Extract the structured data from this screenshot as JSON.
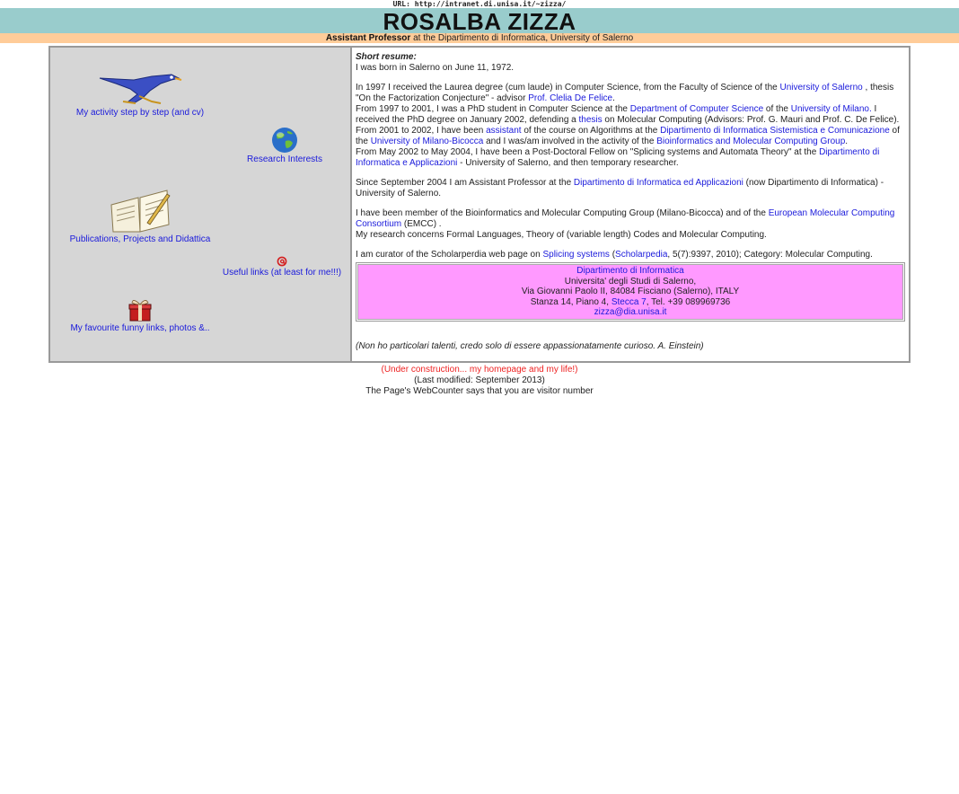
{
  "url_label": "URL: http://intranet.di.unisa.it/~zizza/",
  "title": "ROSALBA ZIZZA",
  "subtitle": {
    "role": "Assistant Professor",
    "affiliation": " at the Dipartimento di Informatica, University of Salerno"
  },
  "nav": {
    "activity": "My activity step by step (and cv)",
    "research": "Research Interests",
    "publications": "Publications, Projects and Didattica",
    "useful": "Useful links (at least for me!!!)",
    "funny": "My favourite funny links, photos &.."
  },
  "resume": {
    "heading": "Short resume:",
    "born": "I was born in  Salerno on June 11, 1972.",
    "p2": {
      "t1": "In 1997 I received the Laurea degree (cum laude) in Computer Science, from the  Faculty of  Science of  the ",
      "l1": "University of  Salerno",
      "t2": " , thesis \"On the Factorization Conjecture\" - advisor  ",
      "l2": "Prof. Clelia De Felice",
      "t3": "."
    },
    "p3": {
      "t1": "From 1997 to 2001, I was a PhD student in Computer Science at the  ",
      "l1": "Department of Computer Science",
      "t2": " of the ",
      "l2": "University of  Milano.",
      "t3": "  I received the PhD degree on January 2002, defending a ",
      "l3": "thesis",
      "t4": " on Molecular Computing (Advisors: Prof. G. Mauri and Prof. C. De Felice)."
    },
    "p4": {
      "t1": "From 2001 to 2002, I have been ",
      "l1": "assistant",
      "t2": " of the course on Algorithms at the  ",
      "l2": "Dipartimento di Informatica Sistemistica e Comunicazione",
      "t3": " of the ",
      "l3": "University of  Milano-Bicocca",
      "t4": " and I was/am involved in the activity of the ",
      "l4": "Bioinformatics and Molecular Computing Group",
      "t5": "."
    },
    "p5": {
      "t1": "From May 2002 to May 2004, I have been a Post-Doctoral Fellow on \"Splicing systems and Automata Theory\" at the ",
      "l1": "Dipartimento di Informatica e Applicazioni",
      "t2": " - University of  Salerno, and then temporary researcher."
    },
    "p6": {
      "t1": "Since September 2004 I am Assistant Professor at the ",
      "l1": "Dipartimento di Informatica ed Applicazioni",
      "t2": " (now Dipartimento di Informatica) - University of  Salerno."
    },
    "p7": {
      "t1": "I have been member of the Bioinformatics and Molecular Computing Group (Milano-Bicocca) and of the ",
      "l1": "European Molecular Computing Consortium",
      "t2": " (EMCC) ."
    },
    "p8": "My research concerns Formal Languages, Theory of  (variable length)  Codes and  Molecular Computing.",
    "p9": {
      "t1": "I am curator of the Scholarperdia web page on ",
      "l1": "Splicing systems",
      "t2": " (",
      "l2": "Scholarpedia",
      "t3": ", 5(7):9397, 2010); Category: Molecular Computing."
    }
  },
  "contact": {
    "dept": "Dipartimento di  Informatica",
    "univ": "Universita' degli Studi di Salerno,",
    "addr": "Via Giovanni Paolo II, 84084 Fisciano (Salerno), ITALY",
    "room_pre": "Stanza 14, Piano 4, ",
    "room_link": "Stecca 7",
    "room_post": ", Tel. +39 089969736",
    "email": "zizza@dia.unisa.it",
    "bg_color": "#ff99ff"
  },
  "quote": "(Non ho particolari talenti,  credo solo di essere appassionatamente curioso. A. Einstein)",
  "footer": {
    "construction": "(Under construction... my homepage and my life!)",
    "modified": "(Last modified: September 2013)",
    "counter": "The Page's WebCounter says that you are visitor number"
  },
  "icons": {
    "activity": "roadrunner-icon",
    "research": "globe-icon",
    "publications": "open-book-icon",
    "useful": "at-sign-icon",
    "funny": "gift-box-icon"
  },
  "colors": {
    "title_bar": "#99cccc",
    "subtitle_bar": "#ffcc99",
    "left_panel": "#d6d6d6",
    "link": "#1a1adb",
    "construction": "#ee2222"
  }
}
